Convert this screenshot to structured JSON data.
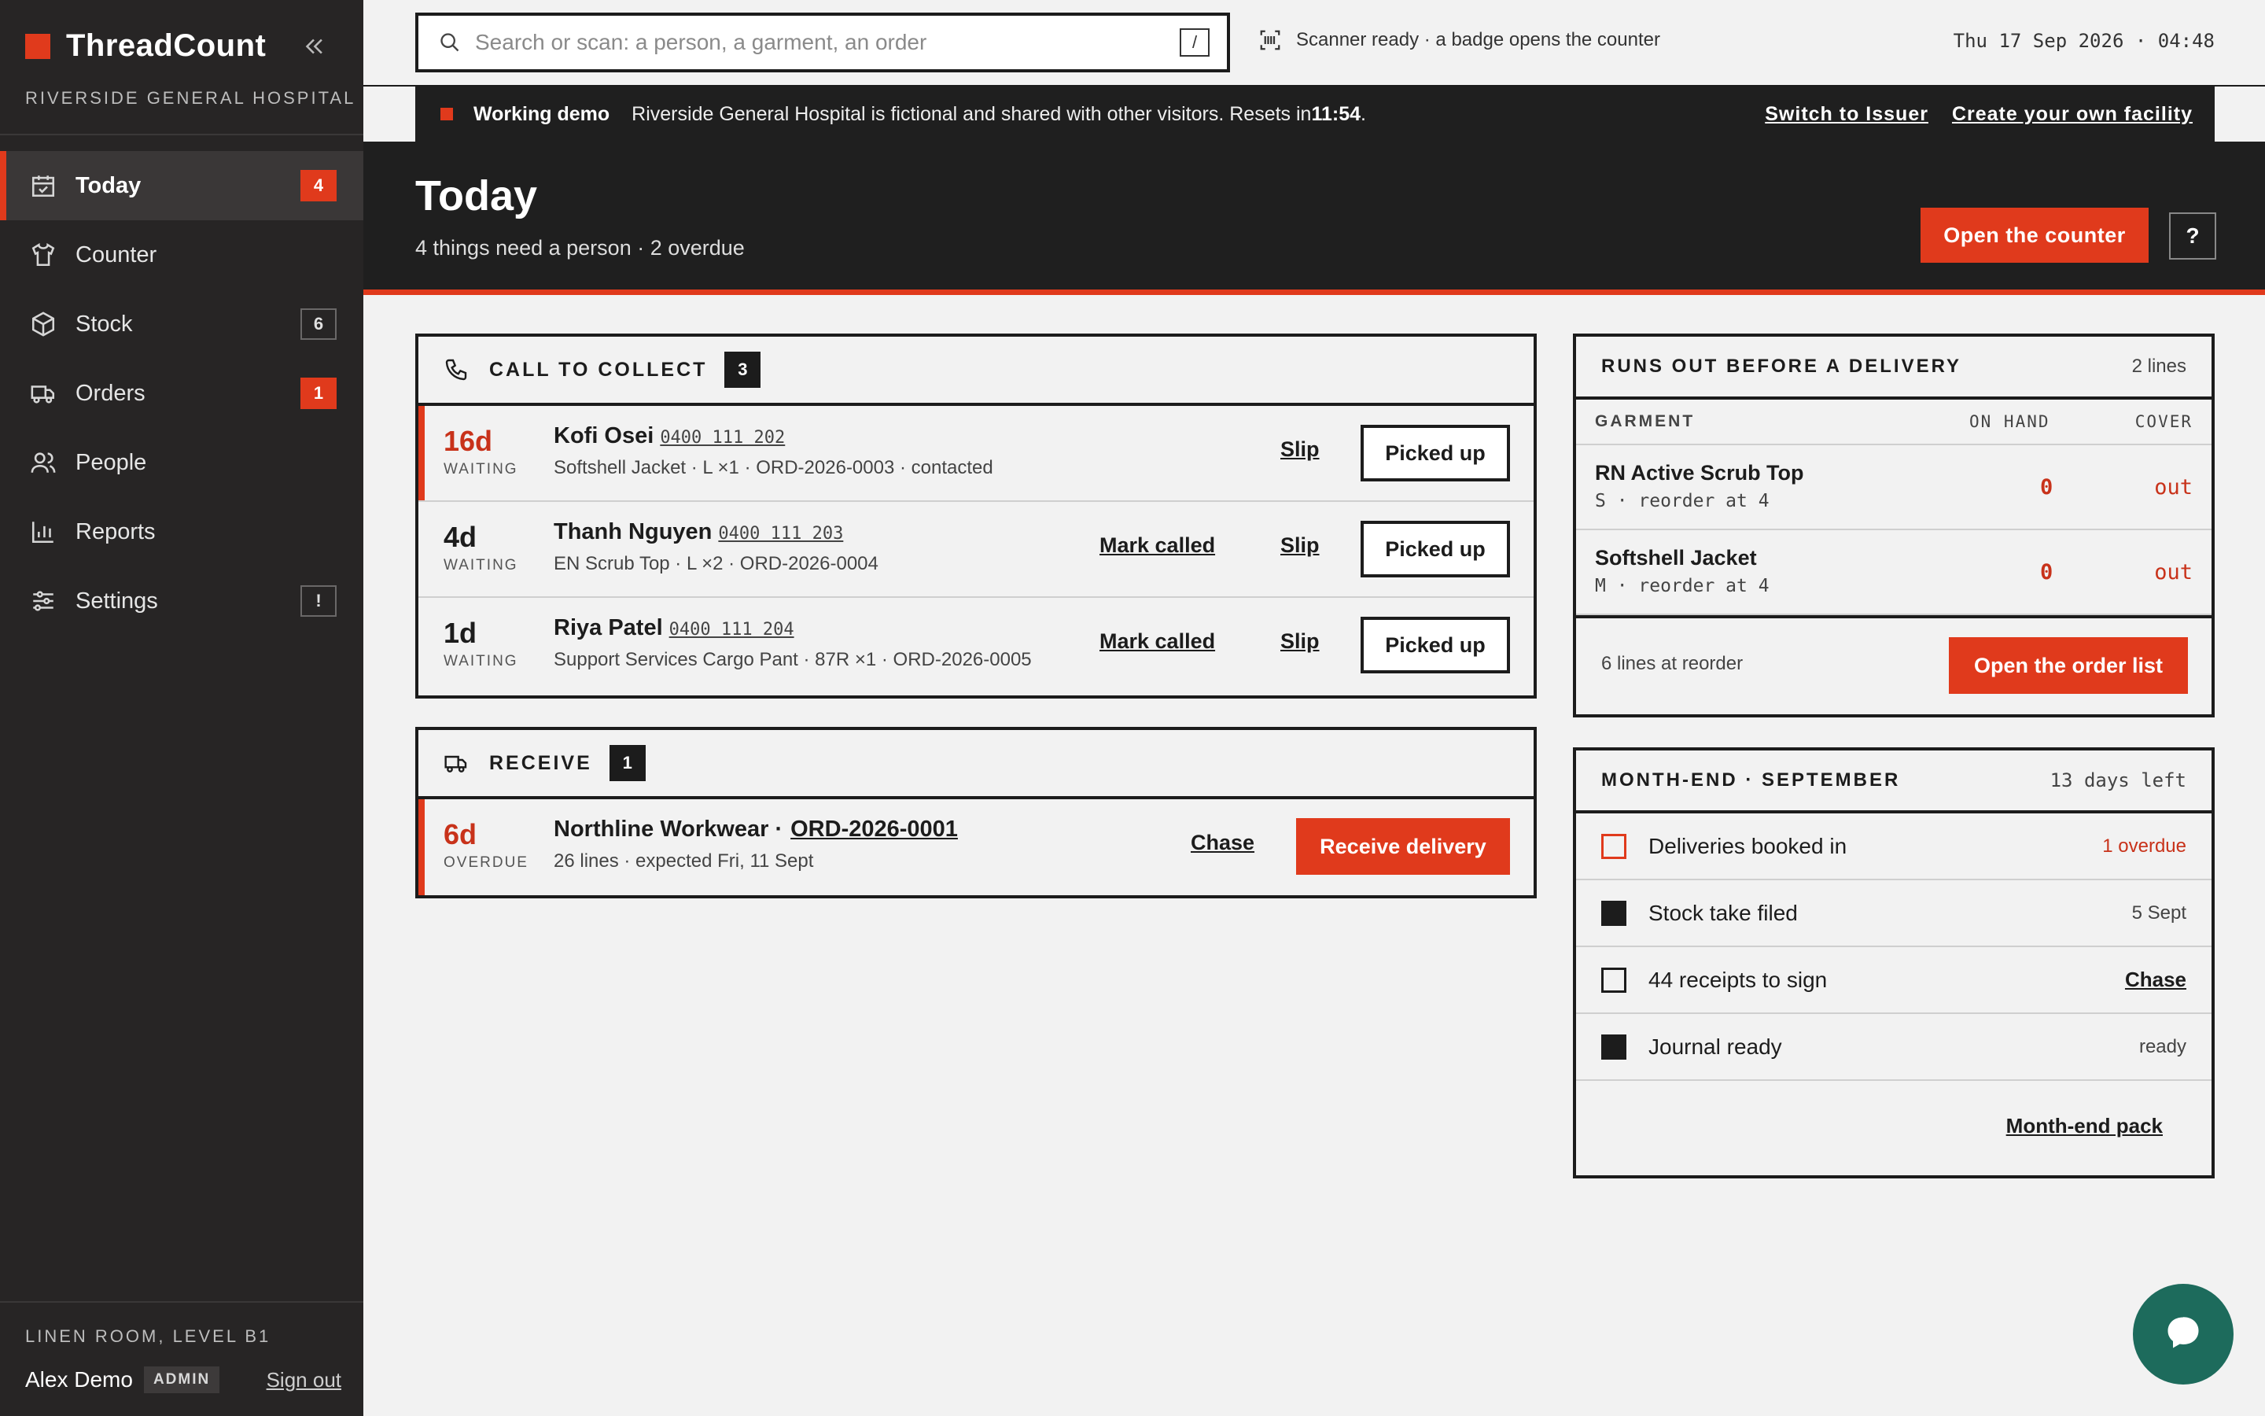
{
  "app": {
    "name": "ThreadCount",
    "facility": "RIVERSIDE GENERAL HOSPITAL"
  },
  "sidebar": {
    "items": [
      {
        "label": "Today",
        "icon": "calendar-check-icon",
        "badge": "4",
        "badge_style": "red",
        "active": true
      },
      {
        "label": "Counter",
        "icon": "shirt-icon",
        "badge": "",
        "badge_style": ""
      },
      {
        "label": "Stock",
        "icon": "box-icon",
        "badge": "6",
        "badge_style": "outline"
      },
      {
        "label": "Orders",
        "icon": "truck-icon",
        "badge": "1",
        "badge_style": "red"
      },
      {
        "label": "People",
        "icon": "people-icon",
        "badge": "",
        "badge_style": ""
      },
      {
        "label": "Reports",
        "icon": "bar-chart-icon",
        "badge": "",
        "badge_style": ""
      },
      {
        "label": "Settings",
        "icon": "sliders-icon",
        "badge": "!",
        "badge_style": "outline"
      }
    ],
    "location": "LINEN ROOM, LEVEL B1",
    "user": {
      "name": "Alex Demo",
      "role": "ADMIN",
      "signout": "Sign out"
    }
  },
  "topbar": {
    "search_placeholder": "Search or scan: a person, a garment, an order",
    "search_shortcut": "/",
    "scanner_status": "Scanner ready · a badge opens the counter",
    "datetime": "Thu 17 Sep 2026 · 04:48"
  },
  "banner": {
    "title": "Working demo",
    "message": "Riverside General Hospital is fictional and shared with other visitors. Resets in ",
    "reset_time": "11:54",
    "message_end": ".",
    "link_switch": "Switch to Issuer",
    "link_create": "Create your own facility"
  },
  "header": {
    "title": "Today",
    "subtitle": "4 things need a person · 2 overdue",
    "open_counter": "Open the counter",
    "help": "?"
  },
  "collect": {
    "title": "CALL TO COLLECT",
    "count": "3",
    "rows": [
      {
        "age": "16d",
        "age_label": "WAITING",
        "name": "Kofi Osei",
        "phone": "0400 111 202",
        "detail": "Softshell Jacket · L ×1 · ORD-2026-0003 · contacted",
        "mark_called": "",
        "slip": "Slip",
        "picked_up": "Picked up"
      },
      {
        "age": "4d",
        "age_label": "WAITING",
        "name": "Thanh Nguyen",
        "phone": "0400 111 203",
        "detail": "EN Scrub Top · L ×2 · ORD-2026-0004",
        "mark_called": "Mark called",
        "slip": "Slip",
        "picked_up": "Picked up"
      },
      {
        "age": "1d",
        "age_label": "WAITING",
        "name": "Riya Patel",
        "phone": "0400 111 204",
        "detail": "Support Services Cargo Pant · 87R ×1 · ORD-2026-0005",
        "mark_called": "Mark called",
        "slip": "Slip",
        "picked_up": "Picked up"
      }
    ]
  },
  "receive": {
    "title": "RECEIVE",
    "count": "1",
    "row": {
      "age": "6d",
      "age_label": "OVERDUE",
      "supplier": "Northline Workwear ·",
      "order": "ORD-2026-0001",
      "detail": "26 lines · expected Fri, 11 Sept",
      "chase": "Chase",
      "receive": "Receive delivery"
    }
  },
  "runs_out": {
    "title": "RUNS OUT BEFORE A DELIVERY",
    "meta": "2 lines",
    "col_garment": "GARMENT",
    "col_onhand": "ON HAND",
    "col_cover": "COVER",
    "rows": [
      {
        "name": "RN Active Scrub Top",
        "sub": "S · reorder at 4",
        "onhand": "0",
        "cover": "out"
      },
      {
        "name": "Softshell Jacket",
        "sub": "M · reorder at 4",
        "onhand": "0",
        "cover": "out"
      }
    ],
    "footer_text": "6 lines at reorder",
    "footer_button": "Open the order list"
  },
  "month_end": {
    "title": "MONTH-END · SEPTEMBER",
    "meta": "13 days left",
    "items": [
      {
        "label": "Deliveries booked in",
        "status": "1 overdue",
        "state": "overdue"
      },
      {
        "label": "Stock take filed",
        "status": "5 Sept",
        "state": "done"
      },
      {
        "label": "44 receipts to sign",
        "status": "Chase",
        "state": "todo"
      },
      {
        "label": "Journal ready",
        "status": "ready",
        "state": "done"
      }
    ],
    "pack_link": "Month-end pack"
  },
  "colors": {
    "accent": "#e03a1c",
    "dark": "#1f1f1f",
    "sidebar": "#272525",
    "chat": "#1d6b5c"
  }
}
